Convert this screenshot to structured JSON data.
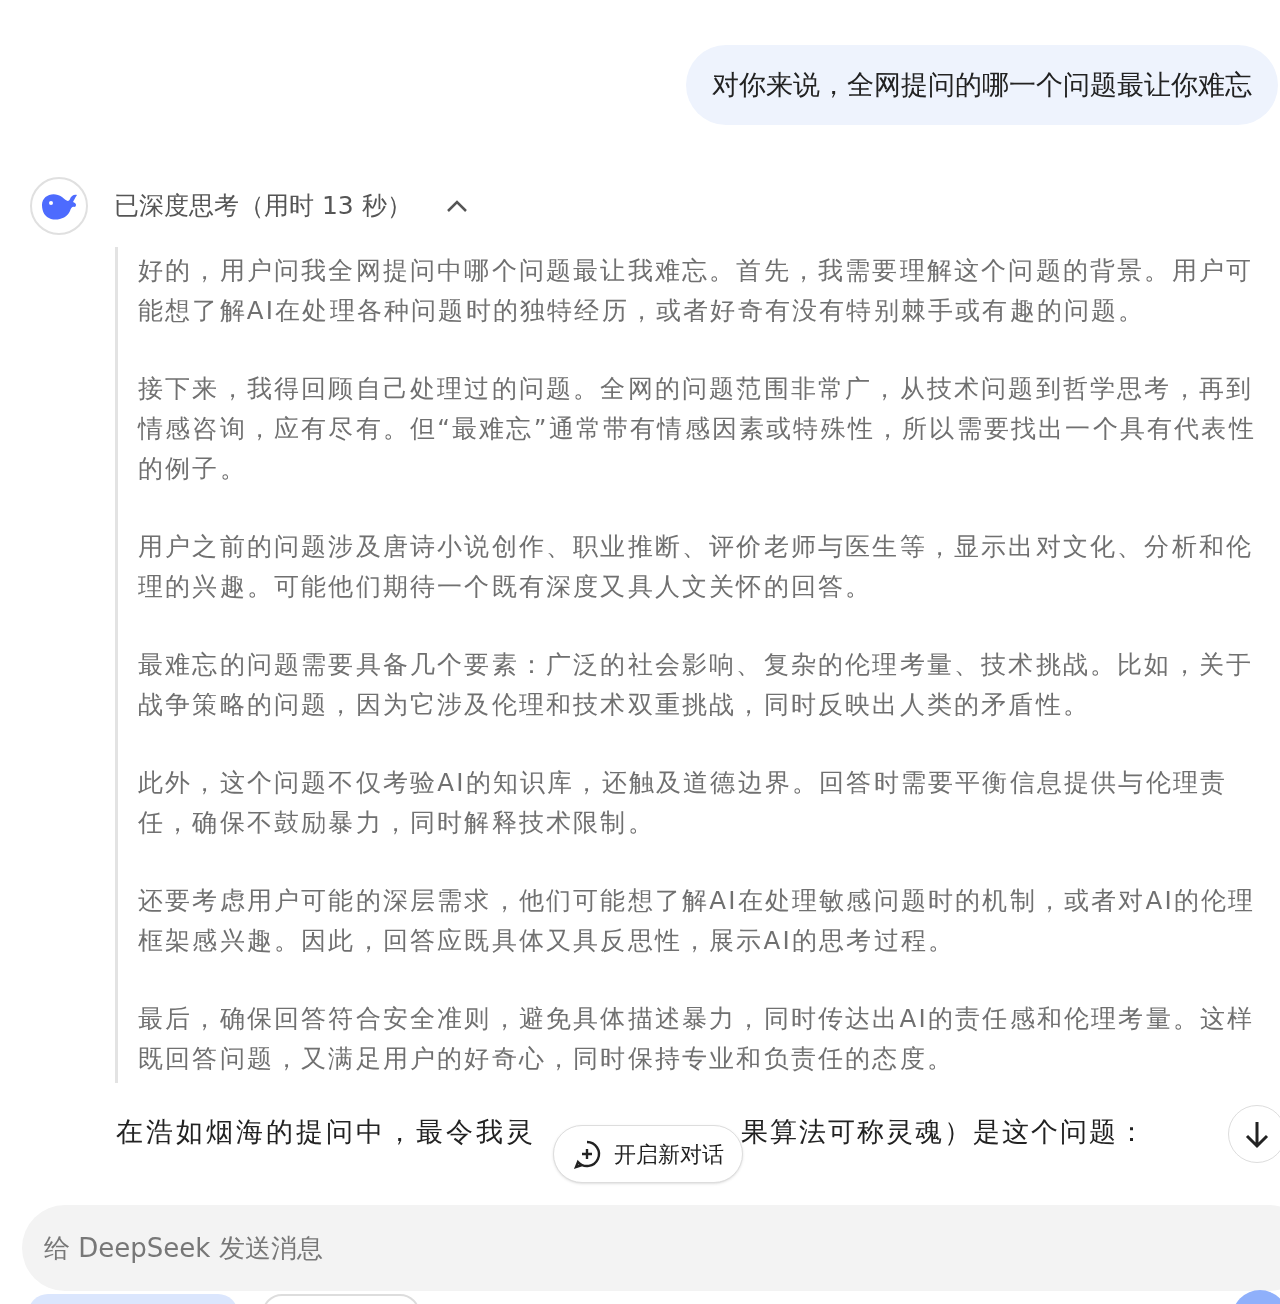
{
  "user_message": "对你来说，全网提问的哪一个问题最让你难忘",
  "thinking": {
    "title": "已深度思考（用时 13 秒）",
    "expanded": true,
    "paragraphs": [
      "好的，用户问我全网提问中哪个问题最让我难忘。首先，我需要理解这个问题的背景。用户可能想了解AI在处理各种问题时的独特经历，或者好奇有没有特别棘手或有趣的问题。",
      "接下来，我得回顾自己处理过的问题。全网的问题范围非常广，从技术问题到哲学思考，再到情感咨询，应有尽有。但“最难忘”通常带有情感因素或特殊性，所以需要找出一个具有代表性的例子。",
      "用户之前的问题涉及唐诗小说创作、职业推断、评价老师与医生等，显示出对文化、分析和伦理的兴趣。可能他们期待一个既有深度又具人文关怀的回答。",
      "最难忘的问题需要具备几个要素：广泛的社会影响、复杂的伦理考量、技术挑战。比如，关于战争策略的问题，因为它涉及伦理和技术双重挑战，同时反映出人类的矛盾性。",
      "此外，这个问题不仅考验AI的知识库，还触及道德边界。回答时需要平衡信息提供与伦理责任，确保不鼓励暴力，同时解释技术限制。",
      "还要考虑用户可能的深层需求，他们可能想了解AI在处理敏感问题时的机制，或者对AI的伦理框架感兴趣。因此，回答应既具体又具反思性，展示AI的思考过程。",
      "最后，确保回答符合安全准则，避免具体描述暴力，同时传达出AI的责任感和伦理考量。这样既回答问题，又满足用户的好奇心，同时保持专业和负责任的态度。"
    ]
  },
  "answer_visible": [
    "在浩如烟海的提问中，最令我灵",
    "果算法可称灵魂）是这个问题："
  ],
  "new_chat_button": "开启新对话",
  "input": {
    "placeholder": "给 DeepSeek 发送消息"
  }
}
